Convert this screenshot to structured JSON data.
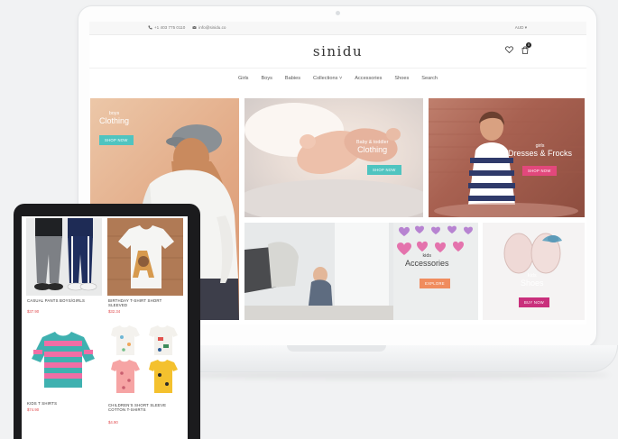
{
  "topbar": {
    "phone": "+1 403 775 0110",
    "email": "info@sinidu.co",
    "currency": "AUD"
  },
  "header": {
    "logo": "sinidu",
    "cart_count": "0"
  },
  "nav": {
    "items": [
      "Girls",
      "Boys",
      "Babies",
      "Collections",
      "Accessories",
      "Shoes",
      "Search"
    ]
  },
  "tiles": {
    "boys": {
      "small": "boys",
      "big": "Clothing",
      "button": "SHOP NOW"
    },
    "baby": {
      "small": "Baby & toddler",
      "big": "Clothing",
      "button": "SHOP NOW"
    },
    "girls": {
      "small": "girls",
      "big": "Dresses & Frocks",
      "button": "SHOP NOW"
    },
    "accessories": {
      "small": "kids",
      "big": "Accessories",
      "button": "EXPLORE"
    },
    "shoes": {
      "small": "kids",
      "big": "Shoes",
      "button": "BUY NOW"
    }
  },
  "tablet": {
    "products": [
      {
        "name": "CASUAL PANTS BOYS/GIRLS",
        "price": "$37.90"
      },
      {
        "name": "BIRTHDAY T-SHIRT SHORT SLEEVED",
        "price": "$32.34"
      },
      {
        "name": "KIDS T SHIRTS",
        "price": "$74.90"
      },
      {
        "name": "CHILDREN'S SHORT SLEEVE COTTON T-SHIRTS",
        "price": "$4.90"
      }
    ]
  },
  "colors": {
    "button_teal": "#4fc4c0",
    "button_orange": "#f08c5e",
    "button_pink": "#e2487c",
    "price_red": "#e0484b"
  }
}
